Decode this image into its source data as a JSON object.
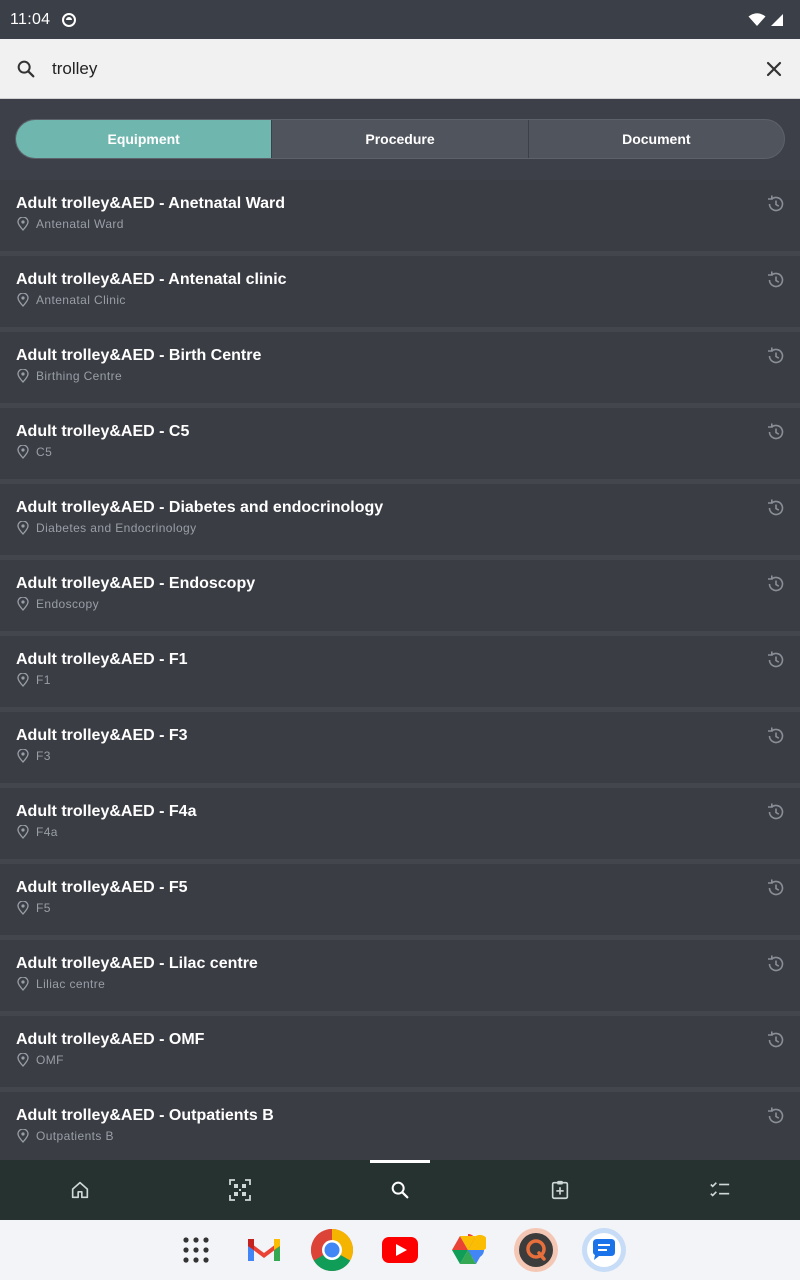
{
  "status": {
    "time": "11:04"
  },
  "search": {
    "query": "trolley",
    "placeholder": ""
  },
  "filters": {
    "tabs": [
      {
        "label": "Equipment",
        "active": true
      },
      {
        "label": "Procedure",
        "active": false
      },
      {
        "label": "Document",
        "active": false
      }
    ]
  },
  "results": [
    {
      "title": "Adult trolley&AED - Anetnatal Ward",
      "location": "Antenatal Ward"
    },
    {
      "title": "Adult trolley&AED - Antenatal clinic",
      "location": "Antenatal Clinic"
    },
    {
      "title": "Adult trolley&AED - Birth Centre",
      "location": "Birthing Centre"
    },
    {
      "title": "Adult trolley&AED - C5",
      "location": "C5"
    },
    {
      "title": "Adult trolley&AED - Diabetes and endocrinology",
      "location": "Diabetes and Endocrinology"
    },
    {
      "title": "Adult trolley&AED - Endoscopy",
      "location": "Endoscopy"
    },
    {
      "title": "Adult trolley&AED - F1",
      "location": "F1"
    },
    {
      "title": "Adult trolley&AED - F3",
      "location": "F3"
    },
    {
      "title": "Adult trolley&AED - F4a",
      "location": "F4a"
    },
    {
      "title": "Adult trolley&AED - F5",
      "location": "F5"
    },
    {
      "title": "Adult trolley&AED - Lilac centre",
      "location": "Liliac centre"
    },
    {
      "title": "Adult trolley&AED - OMF",
      "location": "OMF"
    },
    {
      "title": "Adult trolley&AED - Outpatients B",
      "location": "Outpatients B"
    }
  ],
  "bottom_nav": {
    "items": [
      {
        "icon": "home-icon",
        "active": false
      },
      {
        "icon": "qr-scan-icon",
        "active": false
      },
      {
        "icon": "search-icon",
        "active": true
      },
      {
        "icon": "clipboard-plus-icon",
        "active": false
      },
      {
        "icon": "checklist-icon",
        "active": false
      }
    ]
  },
  "dock": {
    "apps": [
      "app-drawer-icon",
      "gmail-icon",
      "chrome-icon",
      "youtube-icon",
      "photos-icon",
      "quora-app-icon",
      "messages-icon"
    ]
  },
  "colors": {
    "accent": "#6fb6ae",
    "row_bg": "#3a3d44",
    "nav_bg": "#253230"
  }
}
